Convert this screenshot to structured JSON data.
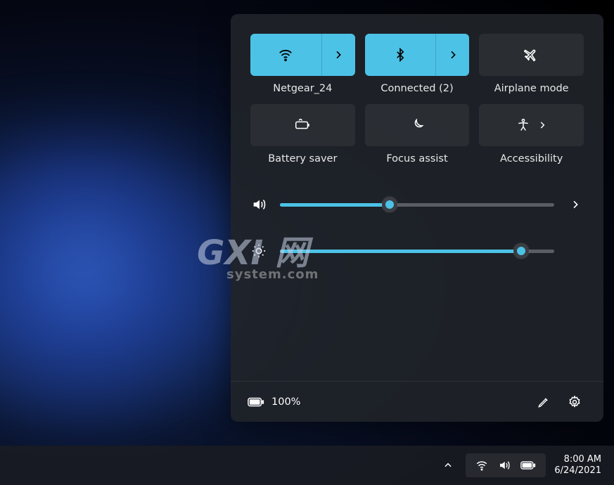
{
  "tiles": {
    "wifi": {
      "label": "Netgear_24",
      "active": true,
      "has_chevron": true
    },
    "bt": {
      "label": "Connected (2)",
      "active": true,
      "has_chevron": true
    },
    "air": {
      "label": "Airplane mode",
      "active": false,
      "has_chevron": false
    },
    "batsav": {
      "label": "Battery saver",
      "active": false,
      "has_chevron": false
    },
    "focus": {
      "label": "Focus assist",
      "active": false,
      "has_chevron": false
    },
    "access": {
      "label": "Accessibility",
      "active": false,
      "has_chevron": true
    }
  },
  "sliders": {
    "volume": {
      "value": 40
    },
    "brightness": {
      "value": 88
    }
  },
  "footer": {
    "battery_pct": "100%"
  },
  "taskbar": {
    "time": "8:00 AM",
    "date": "6/24/2021"
  },
  "watermark": {
    "big": "GXI 网",
    "small": "system.com"
  },
  "colors": {
    "accent": "#4cc2e6"
  }
}
